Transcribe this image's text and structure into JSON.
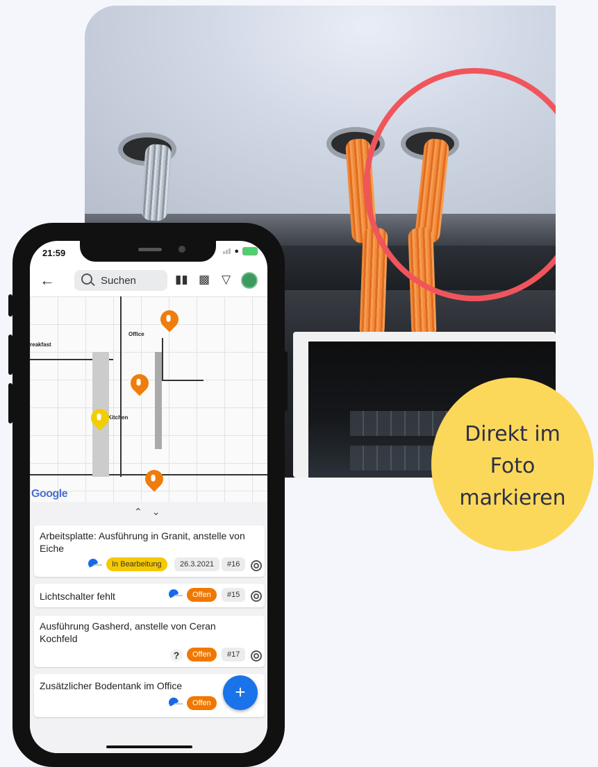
{
  "badge": {
    "text": "Direkt im\nFoto\nmarkieren",
    "color": "#fcd85a"
  },
  "phone": {
    "status": {
      "time": "21:59"
    },
    "toolbar": {
      "search_placeholder": "Suchen"
    },
    "plan": {
      "labels": {
        "office": "Office",
        "kitchen": "Kitchen",
        "breakfast": "reakfast"
      },
      "google": "Google"
    },
    "tasks": [
      {
        "title": "Arbeitsplatte: Ausführung in Granit, anstelle von Eiche",
        "status": "In Bearbeitung",
        "date": "26.3.2021",
        "id": "#16"
      },
      {
        "title": "Lichtschalter fehlt",
        "status": "Offen",
        "id": "#15"
      },
      {
        "title": "Ausführung Gasherd, anstelle von Ceran Kochfeld",
        "status": "Offen",
        "id": "#17",
        "assignee": "?"
      },
      {
        "title": "Zusätzlicher Bodentank im Office",
        "status": "Offen"
      }
    ],
    "fab_label": "+",
    "colors": {
      "in_progress": "#f6c900",
      "open": "#f07800",
      "pin_yellow": "#f2cd00",
      "pin_orange": "#ef7d0b",
      "fab": "#1a73e8"
    }
  },
  "photo": {
    "highlight_ring_color": "#f0555c"
  }
}
